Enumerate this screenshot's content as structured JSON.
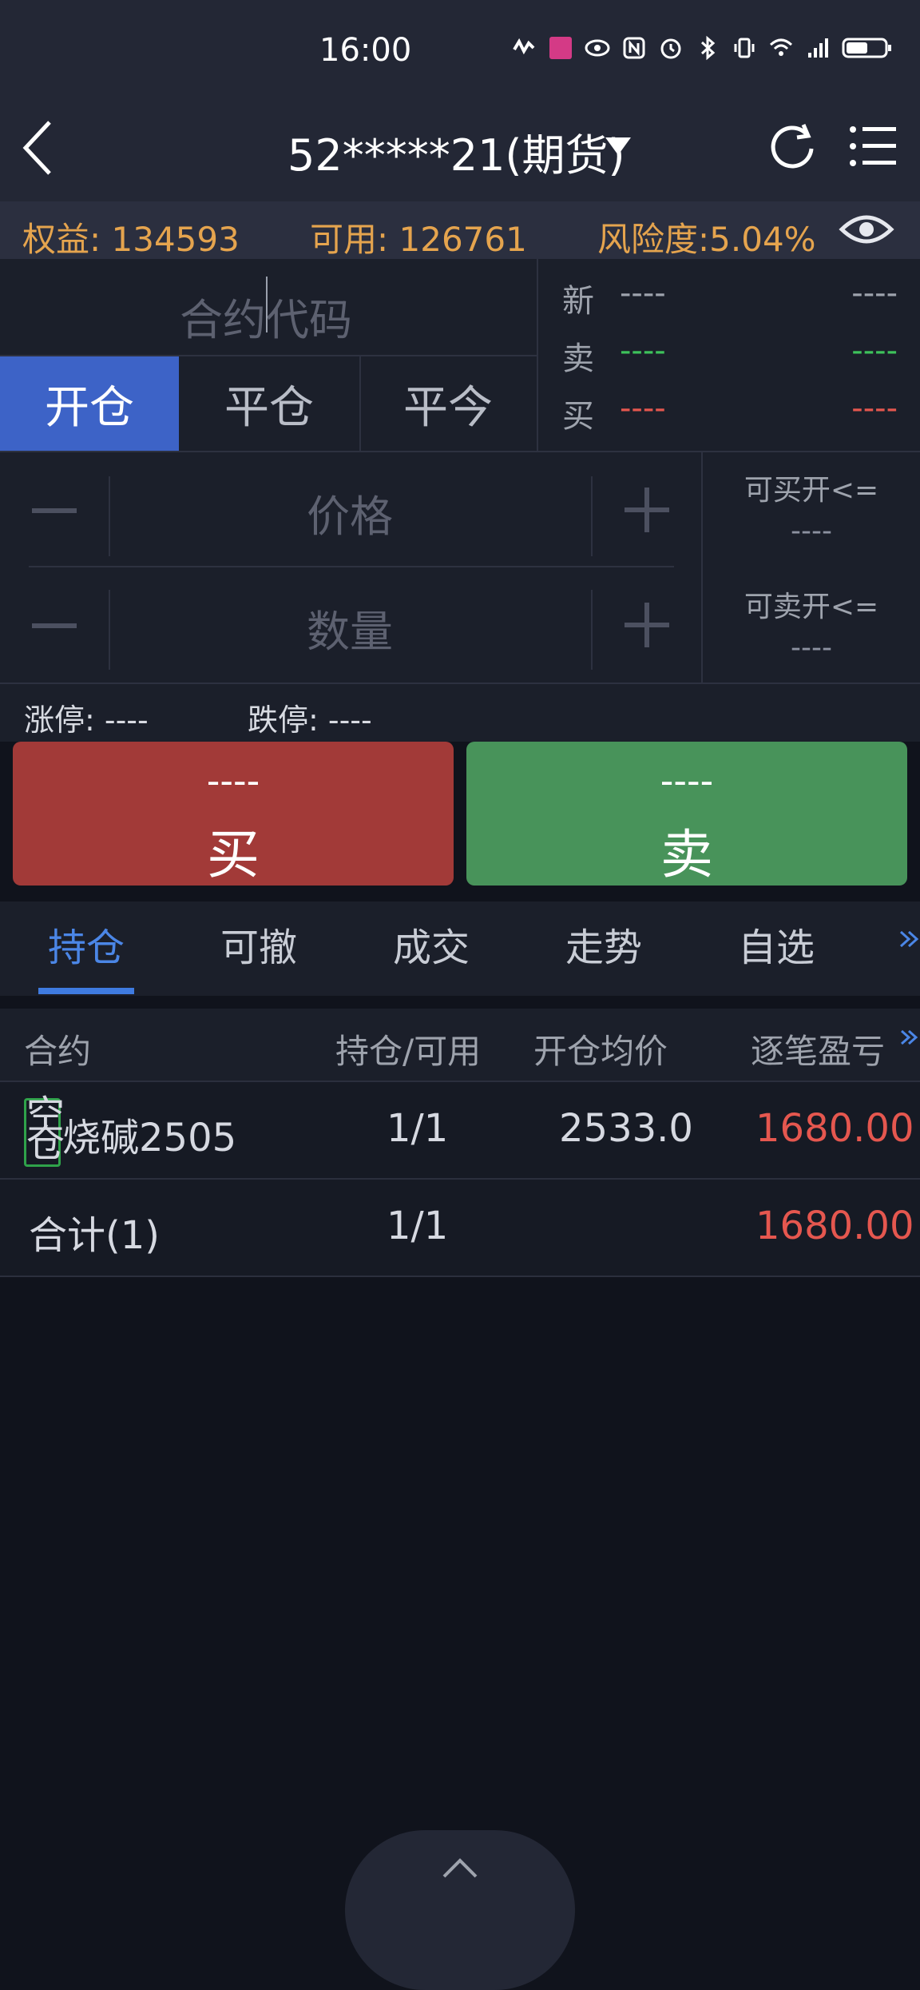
{
  "status_bar": {
    "time": "16:00",
    "icons": [
      "heart-rate-icon",
      "app-badge-icon",
      "eye-icon",
      "nfc-icon",
      "alarm-icon",
      "bluetooth-icon",
      "vibrate-icon",
      "wifi-icon",
      "5g-signal-icon",
      "battery-icon"
    ]
  },
  "nav": {
    "account_title": "52*****21(期货)",
    "back_icon": "back-icon",
    "refresh_icon": "refresh-icon",
    "menu_icon": "menu-icon"
  },
  "summary": {
    "equity": "权益: 134593",
    "available": "可用: 126761",
    "risk": "风险度:5.04%"
  },
  "order_panel": {
    "contract_placeholder": "合约代码",
    "tabs": {
      "open": "开仓",
      "close": "平仓",
      "close_today": "平今"
    },
    "quote": {
      "latest": {
        "label": "新",
        "left": "----",
        "right": "----",
        "color": "#9ea3ad"
      },
      "ask": {
        "label": "卖",
        "left": "----",
        "right": "----",
        "color": "#3ec25b"
      },
      "bid": {
        "label": "买",
        "left": "----",
        "right": "----",
        "color": "#e5574f"
      }
    },
    "price_placeholder": "价格",
    "quantity_placeholder": "数量",
    "can_buy_open": "可买开<=",
    "can_buy_open_value": "----",
    "can_sell_open": "可卖开<=",
    "can_sell_open_value": "----",
    "limit_up": "涨停: ----",
    "limit_down": "跌停: ----",
    "buy": {
      "price": "----",
      "label": "买"
    },
    "sell": {
      "price": "----",
      "label": "卖"
    }
  },
  "lower_tabs": [
    "持仓",
    "可撤",
    "成交",
    "走势",
    "自选"
  ],
  "positions_table": {
    "headers": [
      "合约",
      "持仓/可用",
      "开仓均价",
      "逐笔盈亏"
    ],
    "rows": [
      {
        "badge": "空仓",
        "contract": "烧碱2505",
        "position": "1/1",
        "avg_price": "2533.0",
        "pnl": "1680.00"
      }
    ],
    "total": {
      "label": "合计(1)",
      "position": "1/1",
      "pnl": "1680.00"
    }
  }
}
